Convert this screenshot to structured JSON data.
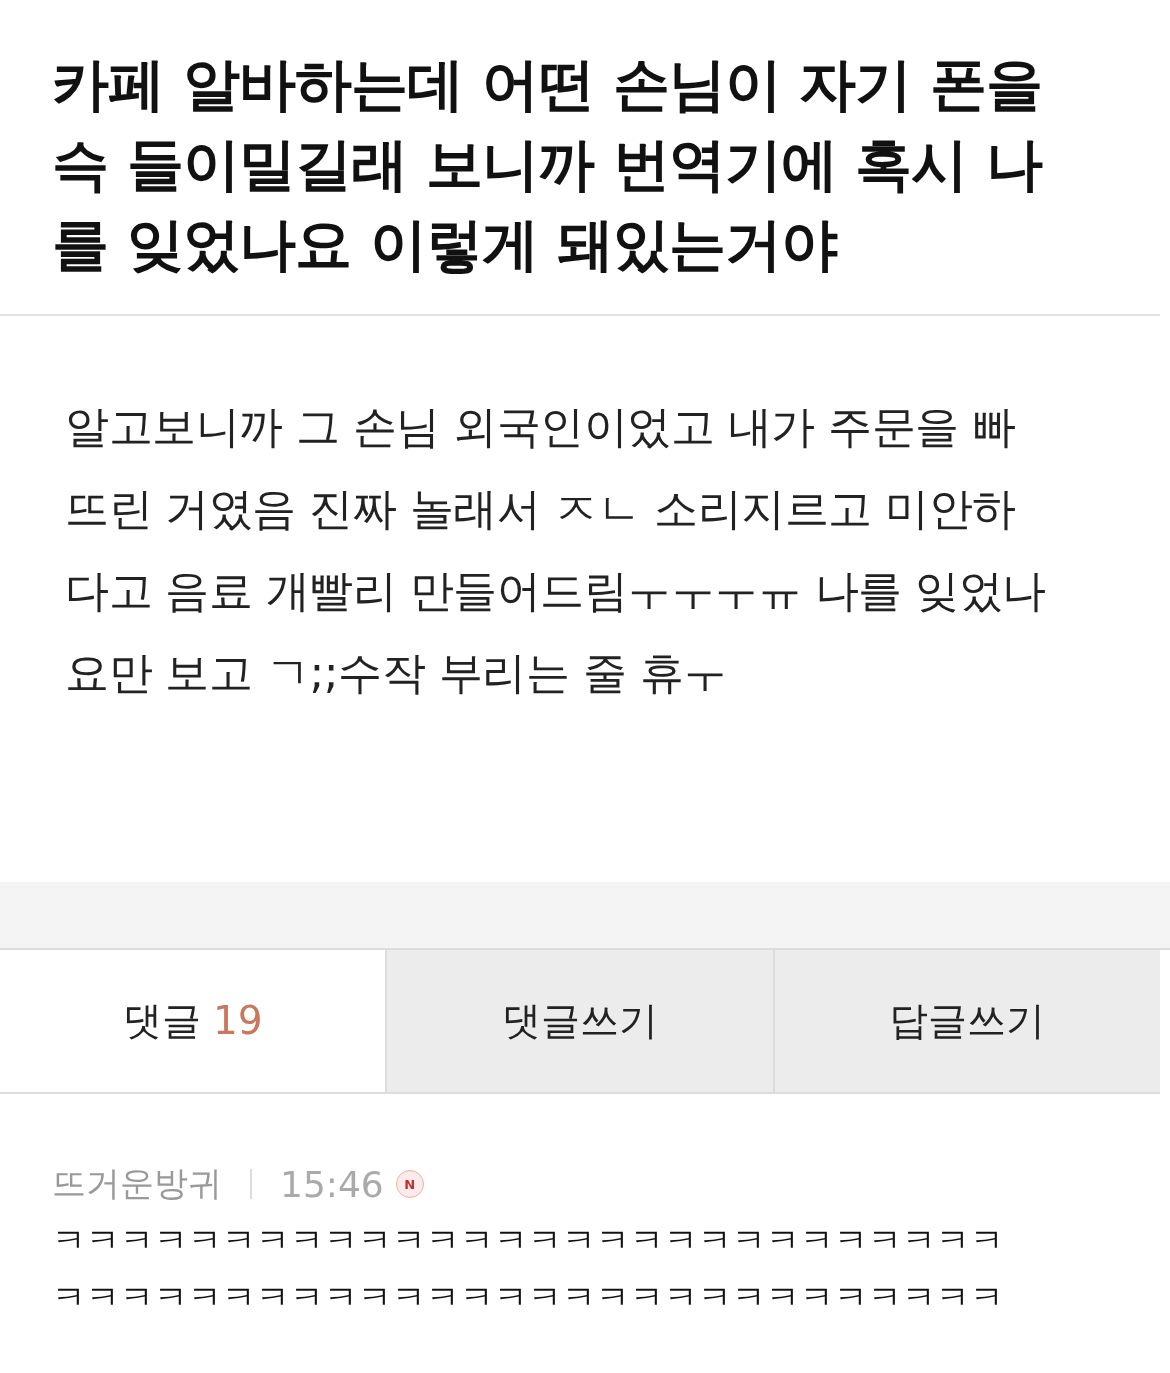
{
  "post": {
    "title_lines": [
      "카페 알바하는데 어떤 손님이 자기 폰을",
      "슥 들이밀길래 보니까 번역기에 혹시 나",
      "를 잊었나요 이렇게 돼있는거야"
    ],
    "body_lines": [
      "알고보니까 그 손님 외국인이었고 내가 주문을 빠",
      "뜨린 거였음 진짜 놀래서 ㅈㄴ 소리지르고 미안하",
      "다고 음료 개빨리 만들어드림ㅜㅜㅜㅠ 나를 잊었나",
      "요만 보고 ㄱ;;수작 부리는 줄 휴ㅜ"
    ]
  },
  "tabs": [
    {
      "label": "댓글",
      "count": "19",
      "selected": true
    },
    {
      "label": "댓글쓰기",
      "selected": false
    },
    {
      "label": "답글쓰기",
      "selected": false
    }
  ],
  "comments": [
    {
      "author": "뜨거운방귀",
      "time": "15:46",
      "new": true,
      "badge": "N",
      "lines": [
        "ㅋㅋㅋㅋㅋㅋㅋㅋㅋㅋㅋㅋㅋㅋㅋㅋㅋㅋㅋㅋㅋㅋㅋㅋㅋㅋㅋㅋ",
        "ㅋㅋㅋㅋㅋㅋㅋㅋㅋㅋㅋㅋㅋㅋㅋㅋㅋㅋㅋㅋㅋㅋㅋㅋㅋㅋㅋㅋ"
      ]
    }
  ]
}
